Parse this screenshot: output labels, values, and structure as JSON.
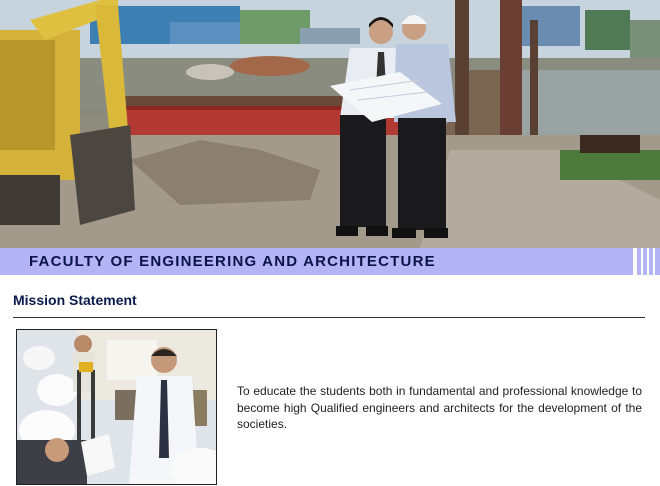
{
  "banner": {
    "title": "FACULTY OF ENGINEERING AND ARCHITECTURE"
  },
  "mission": {
    "heading": "Mission Statement",
    "text": "To educate the students both in fundamental and professional knowledge to become high Qualified engineers and architects for the development of the societies."
  },
  "colors": {
    "band": "#b3b3f5",
    "title_text": "#0a1448",
    "heading_text": "#0a1a4c"
  }
}
